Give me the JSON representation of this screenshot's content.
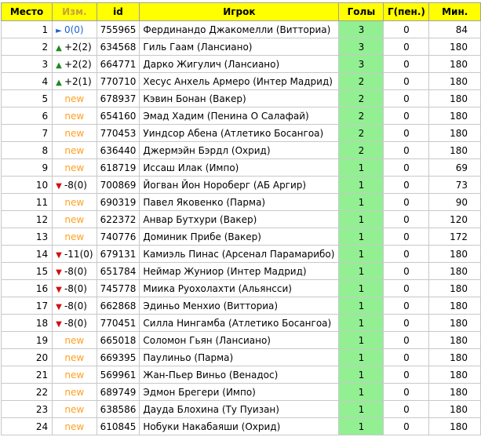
{
  "headers": {
    "rank": "Место",
    "change": "Изм.",
    "id": "id",
    "player": "Игрок",
    "goals": "Голы",
    "pen": "Г(пен.)",
    "min": "Мин."
  },
  "colors": {
    "header_bg": "#ffff00",
    "goals_bg": "#92f093",
    "new": "#ffa020",
    "up": "#1a8a1a",
    "down": "#d01010",
    "same": "#2060d0"
  },
  "rows": [
    {
      "rank": "1",
      "dir": "same",
      "chg": "0(0)",
      "id": "755965",
      "player": "Фердинандо Джакомелли (Витториа)",
      "goals": "3",
      "pen": "0",
      "min": "84"
    },
    {
      "rank": "2",
      "dir": "up",
      "chg": "+2(2)",
      "id": "634568",
      "player": "Гиль Гаам (Лансиано)",
      "goals": "3",
      "pen": "0",
      "min": "180"
    },
    {
      "rank": "3",
      "dir": "up",
      "chg": "+2(2)",
      "id": "664771",
      "player": "Дарко Жигулич (Лансиано)",
      "goals": "3",
      "pen": "0",
      "min": "180"
    },
    {
      "rank": "4",
      "dir": "up",
      "chg": "+2(1)",
      "id": "770710",
      "player": "Хесус Анхель Армеро (Интер Мадрид)",
      "goals": "2",
      "pen": "0",
      "min": "180"
    },
    {
      "rank": "5",
      "dir": "new",
      "chg": "new",
      "id": "678937",
      "player": "Кэвин Бонан (Вакер)",
      "goals": "2",
      "pen": "0",
      "min": "180"
    },
    {
      "rank": "6",
      "dir": "new",
      "chg": "new",
      "id": "654160",
      "player": "Эмад Хадим (Пенина О Салафай)",
      "goals": "2",
      "pen": "0",
      "min": "180"
    },
    {
      "rank": "7",
      "dir": "new",
      "chg": "new",
      "id": "770453",
      "player": "Уиндсор Абена (Атлетико Босангоа)",
      "goals": "2",
      "pen": "0",
      "min": "180"
    },
    {
      "rank": "8",
      "dir": "new",
      "chg": "new",
      "id": "636440",
      "player": "Джермэйн Бэрдл (Охрид)",
      "goals": "2",
      "pen": "0",
      "min": "180"
    },
    {
      "rank": "9",
      "dir": "new",
      "chg": "new",
      "id": "618719",
      "player": "Иссаш Илак (Импо)",
      "goals": "1",
      "pen": "0",
      "min": "69"
    },
    {
      "rank": "10",
      "dir": "down",
      "chg": "-8(0)",
      "id": "700869",
      "player": "Йогван Йон Нороберг (АБ Аргир)",
      "goals": "1",
      "pen": "0",
      "min": "73"
    },
    {
      "rank": "11",
      "dir": "new",
      "chg": "new",
      "id": "690319",
      "player": "Павел Яковенко (Парма)",
      "goals": "1",
      "pen": "0",
      "min": "90"
    },
    {
      "rank": "12",
      "dir": "new",
      "chg": "new",
      "id": "622372",
      "player": "Анвар Бутхури (Вакер)",
      "goals": "1",
      "pen": "0",
      "min": "120"
    },
    {
      "rank": "13",
      "dir": "new",
      "chg": "new",
      "id": "740776",
      "player": "Доминик Прибе (Вакер)",
      "goals": "1",
      "pen": "0",
      "min": "172"
    },
    {
      "rank": "14",
      "dir": "down",
      "chg": "-11(0)",
      "id": "679131",
      "player": "Камиэль Пинас (Арсенал Парамарибо)",
      "goals": "1",
      "pen": "0",
      "min": "180"
    },
    {
      "rank": "15",
      "dir": "down",
      "chg": "-8(0)",
      "id": "651784",
      "player": "Неймар Жуниор (Интер Мадрид)",
      "goals": "1",
      "pen": "0",
      "min": "180"
    },
    {
      "rank": "16",
      "dir": "down",
      "chg": "-8(0)",
      "id": "745778",
      "player": "Миика Руохолахти (Альянсси)",
      "goals": "1",
      "pen": "0",
      "min": "180"
    },
    {
      "rank": "17",
      "dir": "down",
      "chg": "-8(0)",
      "id": "662868",
      "player": "Эдиньо Менхио (Витториа)",
      "goals": "1",
      "pen": "0",
      "min": "180"
    },
    {
      "rank": "18",
      "dir": "down",
      "chg": "-8(0)",
      "id": "770451",
      "player": "Силла Нингамба (Атлетико Босангоа)",
      "goals": "1",
      "pen": "0",
      "min": "180"
    },
    {
      "rank": "19",
      "dir": "new",
      "chg": "new",
      "id": "665018",
      "player": "Соломон Гьян (Лансиано)",
      "goals": "1",
      "pen": "0",
      "min": "180"
    },
    {
      "rank": "20",
      "dir": "new",
      "chg": "new",
      "id": "669395",
      "player": "Паулиньо (Парма)",
      "goals": "1",
      "pen": "0",
      "min": "180"
    },
    {
      "rank": "21",
      "dir": "new",
      "chg": "new",
      "id": "569961",
      "player": "Жан-Пьер Виньо (Венадос)",
      "goals": "1",
      "pen": "0",
      "min": "180"
    },
    {
      "rank": "22",
      "dir": "new",
      "chg": "new",
      "id": "689749",
      "player": "Эдмон Брегери (Импо)",
      "goals": "1",
      "pen": "0",
      "min": "180"
    },
    {
      "rank": "23",
      "dir": "new",
      "chg": "new",
      "id": "638586",
      "player": "Дауда Блохина (Ту Пуизан)",
      "goals": "1",
      "pen": "0",
      "min": "180"
    },
    {
      "rank": "24",
      "dir": "new",
      "chg": "new",
      "id": "610845",
      "player": "Нобуки Накабаяши (Охрид)",
      "goals": "1",
      "pen": "0",
      "min": "180"
    }
  ]
}
